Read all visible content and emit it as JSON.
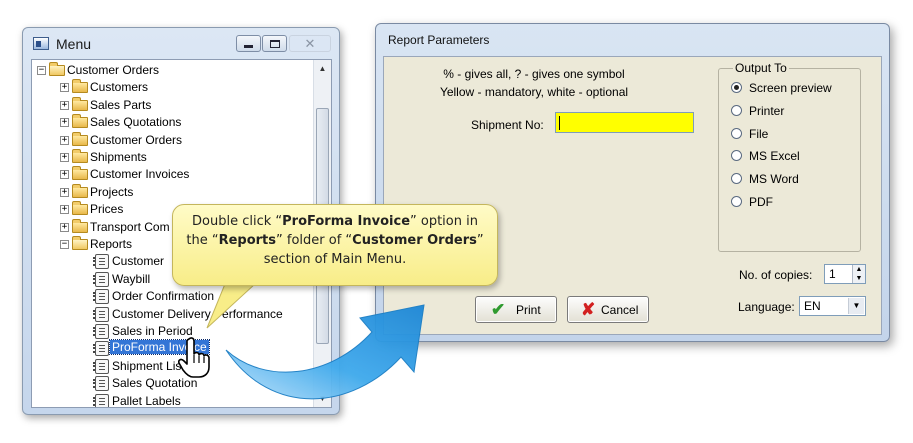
{
  "menu_window": {
    "title": "Menu",
    "controls": {
      "minimize": "minimize",
      "maximize": "maximize",
      "close": "✕"
    },
    "tree": [
      {
        "label": "Customer Orders",
        "type": "folder",
        "toggle": "−",
        "level": 0
      },
      {
        "label": "Customers",
        "type": "folder",
        "toggle": "+",
        "level": 1
      },
      {
        "label": "Sales Parts",
        "type": "folder",
        "toggle": "+",
        "level": 1
      },
      {
        "label": "Sales Quotations",
        "type": "folder",
        "toggle": "+",
        "level": 1
      },
      {
        "label": "Customer Orders",
        "type": "folder",
        "toggle": "+",
        "level": 1
      },
      {
        "label": "Shipments",
        "type": "folder",
        "toggle": "+",
        "level": 1
      },
      {
        "label": "Customer Invoices",
        "type": "folder",
        "toggle": "+",
        "level": 1
      },
      {
        "label": "Projects",
        "type": "folder",
        "toggle": "+",
        "level": 1
      },
      {
        "label": "Prices",
        "type": "folder",
        "toggle": "+",
        "level": 1
      },
      {
        "label": "Transport Com",
        "type": "folder",
        "toggle": "+",
        "level": 1
      },
      {
        "label": "Reports",
        "type": "folder",
        "toggle": "−",
        "level": 1
      },
      {
        "label": "Customer",
        "type": "report",
        "level": 2
      },
      {
        "label": "Waybill",
        "type": "report",
        "level": 2
      },
      {
        "label": "Order Confirmation",
        "type": "report",
        "level": 2
      },
      {
        "label": "Customer Delivery Performance",
        "type": "report",
        "level": 2
      },
      {
        "label": "Sales in Period",
        "type": "report",
        "level": 2
      },
      {
        "label": "ProForma Invoice",
        "type": "report",
        "level": 2,
        "selected": true
      },
      {
        "label": "Shipment List",
        "type": "report",
        "level": 2
      },
      {
        "label": "Sales Quotation",
        "type": "report",
        "level": 2
      },
      {
        "label": "Pallet Labels",
        "type": "report",
        "level": 2
      }
    ]
  },
  "report_window": {
    "title": "Report Parameters",
    "hint_line_1": "% - gives all, ? - gives one symbol",
    "hint_line_2": "Yellow - mandatory, white - optional",
    "shipment_label": "Shipment No:",
    "shipment_value": "",
    "output_group_label": "Output To",
    "output_options": [
      {
        "label": "Screen preview",
        "checked": true
      },
      {
        "label": "Printer",
        "checked": false
      },
      {
        "label": "File",
        "checked": false
      },
      {
        "label": "MS Excel",
        "checked": false
      },
      {
        "label": "MS Word",
        "checked": false
      },
      {
        "label": "PDF",
        "checked": false
      }
    ],
    "copies_label": "No. of copies:",
    "copies_value": "1",
    "language_label": "Language:",
    "language_value": "EN",
    "print_label": "Print",
    "cancel_label": "Cancel"
  },
  "callout": {
    "parts": [
      {
        "text": "Double click “",
        "bold": false
      },
      {
        "text": "ProForma Invoice",
        "bold": true
      },
      {
        "text": "” option in the “",
        "bold": false
      },
      {
        "text": "Reports",
        "bold": true
      },
      {
        "text": "” folder of “",
        "bold": false
      },
      {
        "text": "Customer Orders",
        "bold": true
      },
      {
        "text": "” section of Main Menu.",
        "bold": false
      }
    ]
  },
  "colors": {
    "mandatory_field": "#ffff00",
    "selection": "#3375d6",
    "callout_bg": "#fbf3a4",
    "arrow_blue": "#2a9be4",
    "print_icon": "#2f9a2f",
    "cancel_icon": "#d22020"
  },
  "icons": {
    "print": "checkmark-icon",
    "cancel": "x-icon",
    "cursor": "hand-pointer-icon",
    "folder": "folder-icon",
    "report": "report-icon"
  }
}
